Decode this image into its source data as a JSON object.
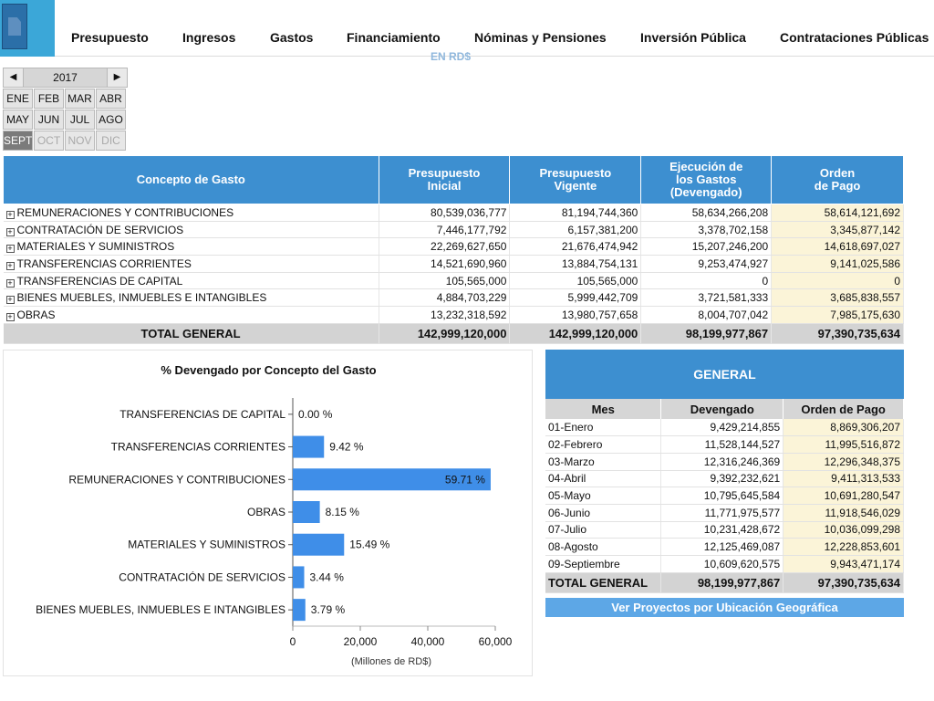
{
  "nav": {
    "items": [
      "Presupuesto",
      "Ingresos",
      "Gastos",
      "Financiamiento",
      "Nóminas y Pensiones",
      "Inversión Pública",
      "Contrataciones Públicas"
    ],
    "subtitle_peek": "EN RD$"
  },
  "calendar": {
    "year": "2017",
    "prev_icon": "◀",
    "next_icon": "▶",
    "months": [
      {
        "label": "ENE",
        "state": "normal"
      },
      {
        "label": "FEB",
        "state": "normal"
      },
      {
        "label": "MAR",
        "state": "normal"
      },
      {
        "label": "ABR",
        "state": "normal"
      },
      {
        "label": "MAY",
        "state": "normal"
      },
      {
        "label": "JUN",
        "state": "normal"
      },
      {
        "label": "JUL",
        "state": "normal"
      },
      {
        "label": "AGO",
        "state": "normal"
      },
      {
        "label": "SEPT",
        "state": "selected"
      },
      {
        "label": "OCT",
        "state": "disabled"
      },
      {
        "label": "NOV",
        "state": "disabled"
      },
      {
        "label": "DIC",
        "state": "disabled"
      }
    ]
  },
  "budget_table": {
    "headers": [
      "Concepto de Gasto",
      "Presupuesto\nInicial",
      "Presupuesto\nVigente",
      "Ejecución de\nlos Gastos\n(Devengado)",
      "Orden\nde Pago"
    ],
    "expand_icon": "+",
    "rows": [
      {
        "concepto": "REMUNERACIONES Y CONTRIBUCIONES",
        "inicial": "80,539,036,777",
        "vigente": "81,194,744,360",
        "devengado": "58,634,266,208",
        "orden": "58,614,121,692"
      },
      {
        "concepto": "CONTRATACIÓN DE SERVICIOS",
        "inicial": "7,446,177,792",
        "vigente": "6,157,381,200",
        "devengado": "3,378,702,158",
        "orden": "3,345,877,142"
      },
      {
        "concepto": "MATERIALES Y SUMINISTROS",
        "inicial": "22,269,627,650",
        "vigente": "21,676,474,942",
        "devengado": "15,207,246,200",
        "orden": "14,618,697,027"
      },
      {
        "concepto": "TRANSFERENCIAS CORRIENTES",
        "inicial": "14,521,690,960",
        "vigente": "13,884,754,131",
        "devengado": "9,253,474,927",
        "orden": "9,141,025,586"
      },
      {
        "concepto": "TRANSFERENCIAS DE CAPITAL",
        "inicial": "105,565,000",
        "vigente": "105,565,000",
        "devengado": "0",
        "orden": "0"
      },
      {
        "concepto": "BIENES MUEBLES, INMUEBLES E INTANGIBLES",
        "inicial": "4,884,703,229",
        "vigente": "5,999,442,709",
        "devengado": "3,721,581,333",
        "orden": "3,685,838,557"
      },
      {
        "concepto": "OBRAS",
        "inicial": "13,232,318,592",
        "vigente": "13,980,757,658",
        "devengado": "8,004,707,042",
        "orden": "7,985,175,630"
      }
    ],
    "total": {
      "label": "TOTAL GENERAL",
      "inicial": "142,999,120,000",
      "vigente": "142,999,120,000",
      "devengado": "98,199,977,867",
      "orden": "97,390,735,634"
    }
  },
  "chart_title": "% Devengado por Concepto del Gasto",
  "chart_data": {
    "type": "bar",
    "orientation": "horizontal",
    "title": "% Devengado por Concepto del Gasto",
    "xlabel": "(Millones de RD$)",
    "ylabel": "",
    "xlim": [
      0,
      60000
    ],
    "xticks": [
      "0",
      "20,000",
      "40,000",
      "60,000"
    ],
    "categories": [
      "TRANSFERENCIAS DE CAPITAL",
      "TRANSFERENCIAS CORRIENTES",
      "REMUNERACIONES Y CONTRIBUCIONES",
      "OBRAS",
      "MATERIALES Y SUMINISTROS",
      "CONTRATACIÓN DE SERVICIOS",
      "BIENES MUEBLES, INMUEBLES E INTANGIBLES"
    ],
    "values": [
      0,
      9253.47,
      58634.27,
      8004.71,
      15207.25,
      3378.7,
      3721.58
    ],
    "labels": [
      "0.00 %",
      "9.42 %",
      "59.71 %",
      "8.15 %",
      "15.49 %",
      "3.44 %",
      "3.79 %"
    ],
    "bar_color": "#3f8ee8",
    "grid": false
  },
  "general": {
    "title": "GENERAL",
    "headers": [
      "Mes",
      "Devengado",
      "Orden de Pago"
    ],
    "rows": [
      {
        "mes": "01-Enero",
        "devengado": "9,429,214,855",
        "orden": "8,869,306,207"
      },
      {
        "mes": "02-Febrero",
        "devengado": "11,528,144,527",
        "orden": "11,995,516,872"
      },
      {
        "mes": "03-Marzo",
        "devengado": "12,316,246,369",
        "orden": "12,296,348,375"
      },
      {
        "mes": "04-Abril",
        "devengado": "9,392,232,621",
        "orden": "9,411,313,533"
      },
      {
        "mes": "05-Mayo",
        "devengado": "10,795,645,584",
        "orden": "10,691,280,547"
      },
      {
        "mes": "06-Junio",
        "devengado": "11,771,975,577",
        "orden": "11,918,546,029"
      },
      {
        "mes": "07-Julio",
        "devengado": "10,231,428,672",
        "orden": "10,036,099,298"
      },
      {
        "mes": "08-Agosto",
        "devengado": "12,125,469,087",
        "orden": "12,228,853,601"
      },
      {
        "mes": "09-Septiembre",
        "devengado": "10,609,620,575",
        "orden": "9,943,471,174"
      }
    ],
    "total": {
      "label": "TOTAL GENERAL",
      "devengado": "98,199,977,867",
      "orden": "97,390,735,634"
    },
    "geo_button": "Ver Proyectos por Ubicación Geográfica"
  }
}
